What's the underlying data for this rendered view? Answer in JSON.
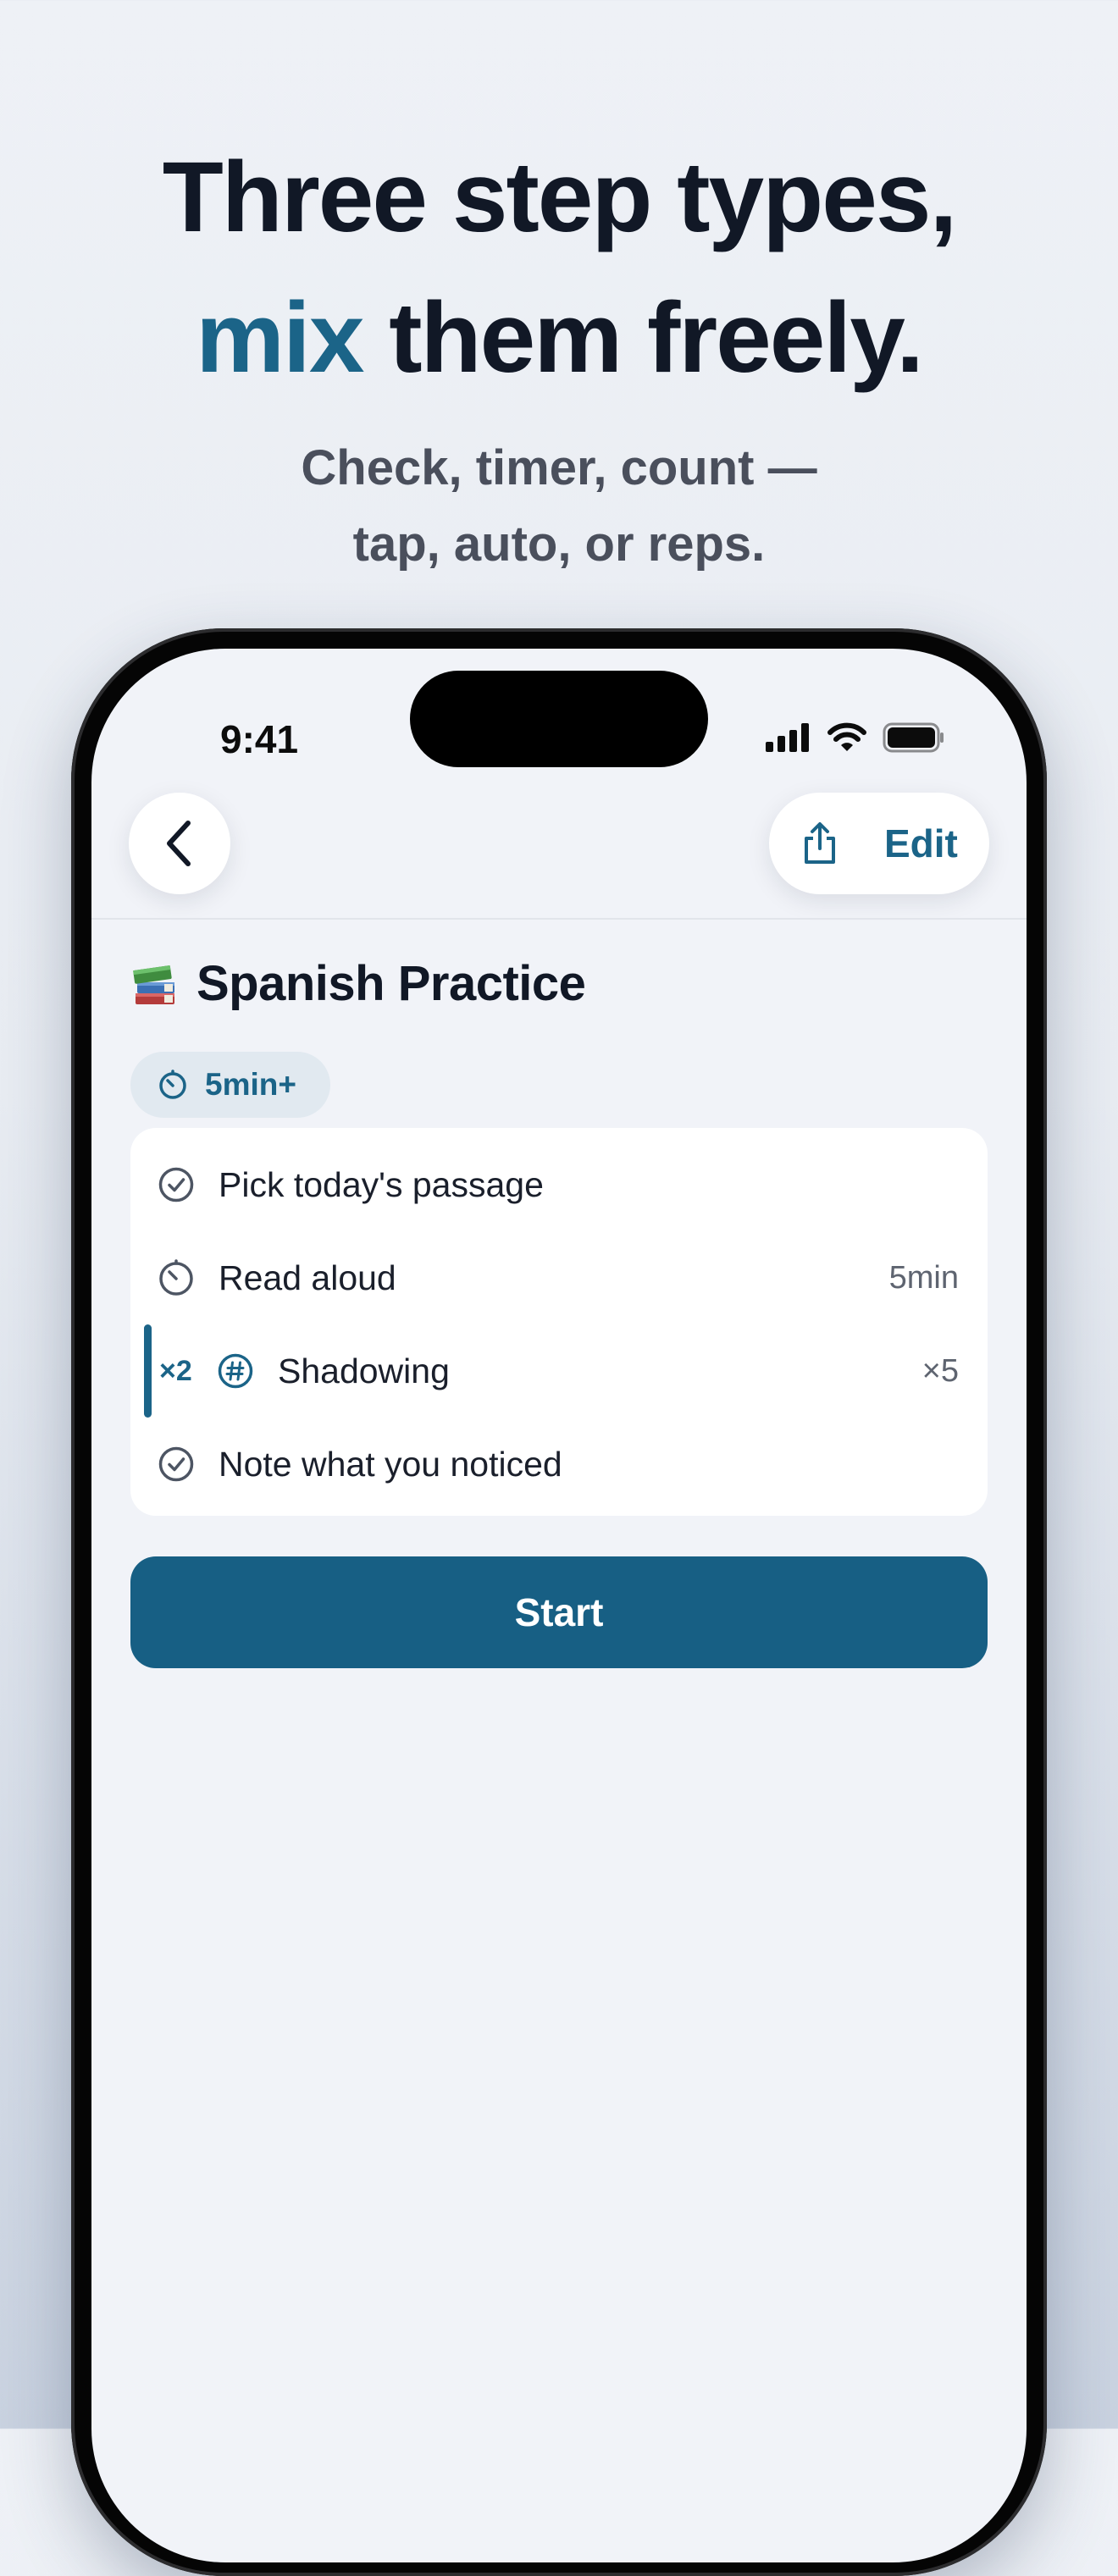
{
  "headline": {
    "line1": "Three step types,",
    "line2_accent": "mix",
    "line2_rest": " them freely."
  },
  "subhead": {
    "line1": "Check, timer, count —",
    "line2": "tap, auto, or reps."
  },
  "status_bar": {
    "time": "9:41"
  },
  "nav": {
    "edit_label": "Edit"
  },
  "routine": {
    "emoji": "books",
    "title": "Spanish Practice",
    "duration": "5min+"
  },
  "steps": [
    {
      "type": "check",
      "icon": "check-circle-icon",
      "label": "Pick today's passage",
      "meta": ""
    },
    {
      "type": "timer",
      "icon": "timer-icon",
      "label": "Read aloud",
      "meta": "5min"
    },
    {
      "type": "count",
      "icon": "hash-icon",
      "label": "Shadowing",
      "meta": "×5",
      "group_multiplier": "×2"
    },
    {
      "type": "check",
      "icon": "check-circle-icon",
      "label": "Note what you noticed",
      "meta": ""
    }
  ],
  "start_button": {
    "label": "Start"
  },
  "colors": {
    "accent": "#1b6488",
    "button": "#175f84",
    "background": "#f1f3f8"
  }
}
